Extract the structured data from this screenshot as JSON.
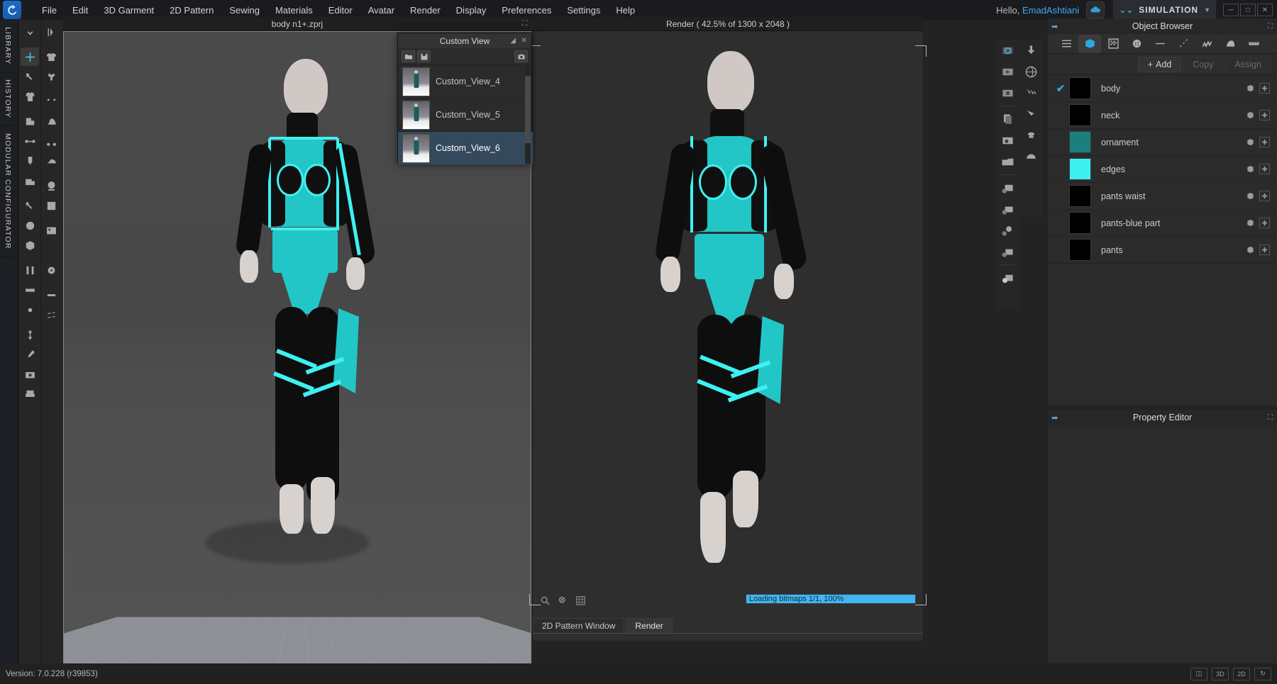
{
  "app": {
    "logo_icon": "clo-logo-icon",
    "greeting_prefix": "Hello, ",
    "user_name": "EmadAshtiani",
    "cloud_icon": "cloud-icon",
    "mode_label": "SIMULATION",
    "mode_chevron_icon": "double-chevron-down-icon",
    "mode_caret_icon": "caret-down-icon",
    "window_minimize": "─",
    "window_maximize": "□",
    "window_close": "✕"
  },
  "menu": [
    "File",
    "Edit",
    "3D Garment",
    "2D Pattern",
    "Sewing",
    "Materials",
    "Editor",
    "Avatar",
    "Render",
    "Display",
    "Preferences",
    "Settings",
    "Help"
  ],
  "vertical_tabs": [
    "LIBRARY",
    "HISTORY",
    "MODULAR CONFIGURATOR"
  ],
  "viewport_3d": {
    "title": "body n1+.zprj",
    "popout_icon": "popout-icon"
  },
  "custom_view": {
    "title": "Custom View",
    "pin_icon": "pin-icon",
    "close_icon": "close-icon",
    "open_icon": "folder-open-icon",
    "save_icon": "save-icon",
    "capture_icon": "camera-capture-icon",
    "items": [
      {
        "label": "Custom_View_4",
        "selected": false
      },
      {
        "label": "Custom_View_5",
        "selected": false
      },
      {
        "label": "Custom_View_6",
        "selected": true
      }
    ]
  },
  "render_view": {
    "title": "Render ( 42.5% of 1300 x 2048 )",
    "zoom_100_icon": "zoom-100-icon",
    "zoom_fit_icon": "zoom-fit-icon",
    "grid_icon": "grid-icon",
    "progress_text": "Loading bitmaps 1/1, 100%",
    "progress_percent": 100,
    "progress_color": "#41b6f0",
    "tabs": [
      {
        "label": "2D Pattern Window",
        "active": false
      },
      {
        "label": "Render",
        "active": true
      }
    ]
  },
  "object_browser": {
    "title": "Object Browser",
    "pin_icon": "pin-arrow-icon",
    "popout_icon": "popout-icon",
    "tabs": [
      {
        "icon": "list-icon",
        "selected": false
      },
      {
        "icon": "fabric-icon",
        "selected": true
      },
      {
        "icon": "checker-pattern-icon",
        "selected": false
      },
      {
        "icon": "button-icon",
        "selected": false
      },
      {
        "icon": "line-icon",
        "selected": false
      },
      {
        "icon": "stitch-icon",
        "selected": false
      },
      {
        "icon": "zigzag-icon",
        "selected": false
      },
      {
        "icon": "fold-icon",
        "selected": false
      },
      {
        "icon": "ruler-icon",
        "selected": false
      }
    ],
    "add_label": "Add",
    "add_icon": "plus-icon",
    "copy_label": "Copy",
    "assign_label": "Assign",
    "rows": [
      {
        "name": "body",
        "color": "#000000",
        "checked": true,
        "edit_icon": "fabric-mini-icon",
        "assign_icon": "assign-mini-icon"
      },
      {
        "name": "neck",
        "color": "#000000",
        "checked": false,
        "edit_icon": "fabric-mini-icon",
        "assign_icon": "assign-mini-icon"
      },
      {
        "name": "ornament",
        "color": "#1b7f7f",
        "checked": false,
        "edit_icon": "fabric-mini-icon",
        "assign_icon": "assign-mini-icon"
      },
      {
        "name": "edges",
        "color": "#3ff0f0",
        "checked": false,
        "edit_icon": "fabric-mini-icon",
        "assign_icon": "assign-mini-icon"
      },
      {
        "name": "pants waist",
        "color": "#000000",
        "checked": false,
        "edit_icon": "fabric-mini-icon",
        "assign_icon": "assign-mini-icon"
      },
      {
        "name": "pants-blue part",
        "color": "#000000",
        "checked": false,
        "edit_icon": "fabric-mini-icon",
        "assign_icon": "assign-mini-icon"
      },
      {
        "name": "pants",
        "color": "#000000",
        "checked": false,
        "edit_icon": "fabric-mini-icon",
        "assign_icon": "assign-mini-icon"
      }
    ]
  },
  "property_editor": {
    "title": "Property Editor",
    "pin_icon": "pin-arrow-icon",
    "popout_icon": "popout-icon"
  },
  "status_bar": {
    "version": "Version: 7.0.228 (r39853)",
    "buttons": [
      "",
      "3D",
      "2D",
      "↻"
    ]
  }
}
